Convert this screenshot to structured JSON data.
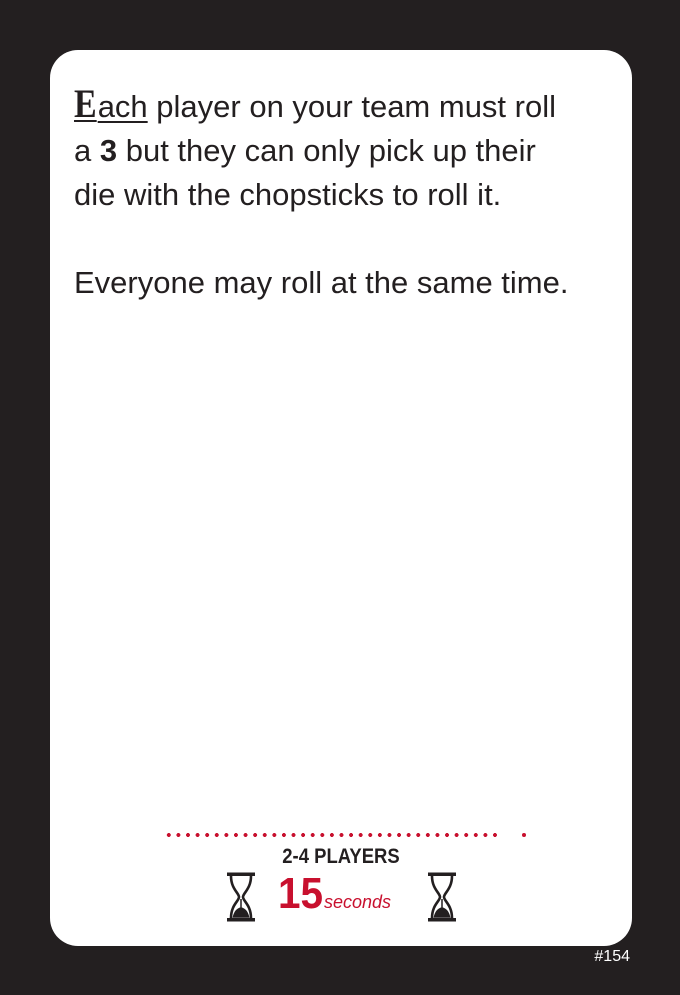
{
  "card": {
    "drop_cap": "E",
    "first_word_rest": "ach",
    "line1_text": " player on your team must roll",
    "line2_pre": "a ",
    "line2_number": "3",
    "line2_post": " but they can only pick up their",
    "line3_text": "die with the chopsticks to roll it.",
    "paragraph2": "Everyone may roll at the same time."
  },
  "footer": {
    "players": "2-4 PLAYERS",
    "time_value": "15",
    "time_unit": "seconds",
    "icon": "hourglass-icon",
    "accent_color": "#c8102e"
  },
  "card_number": "#154",
  "colors": {
    "background": "#231f20",
    "card": "#ffffff",
    "text": "#231f20",
    "accent": "#c8102e"
  }
}
